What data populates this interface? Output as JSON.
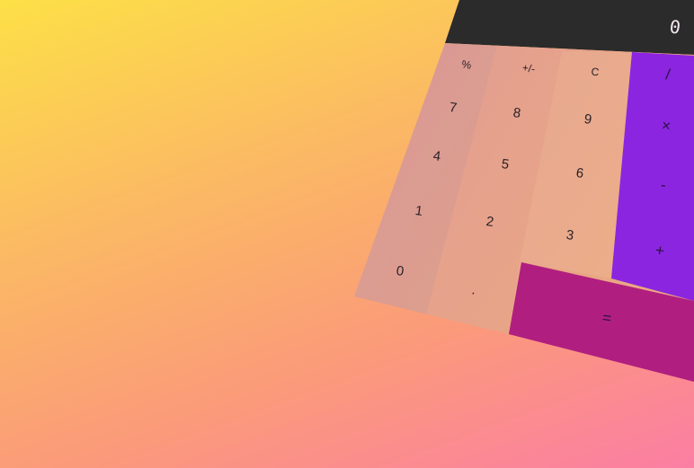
{
  "display": {
    "value": "0"
  },
  "keys": {
    "percent": "%",
    "sign": "+/-",
    "clear": "C",
    "divide": "/",
    "seven": "7",
    "eight": "8",
    "nine": "9",
    "multiply": "×",
    "four": "4",
    "five": "5",
    "six": "6",
    "subtract": "-",
    "one": "1",
    "two": "2",
    "three": "3",
    "add": "+",
    "zero": "0",
    "decimal": ".",
    "equals": "="
  },
  "colors": {
    "display_bg": "#2b2b2b",
    "operator_bg": "#8b25e0",
    "equals_bg": "#b01f80",
    "keypad_bg": "#e4a08e"
  }
}
